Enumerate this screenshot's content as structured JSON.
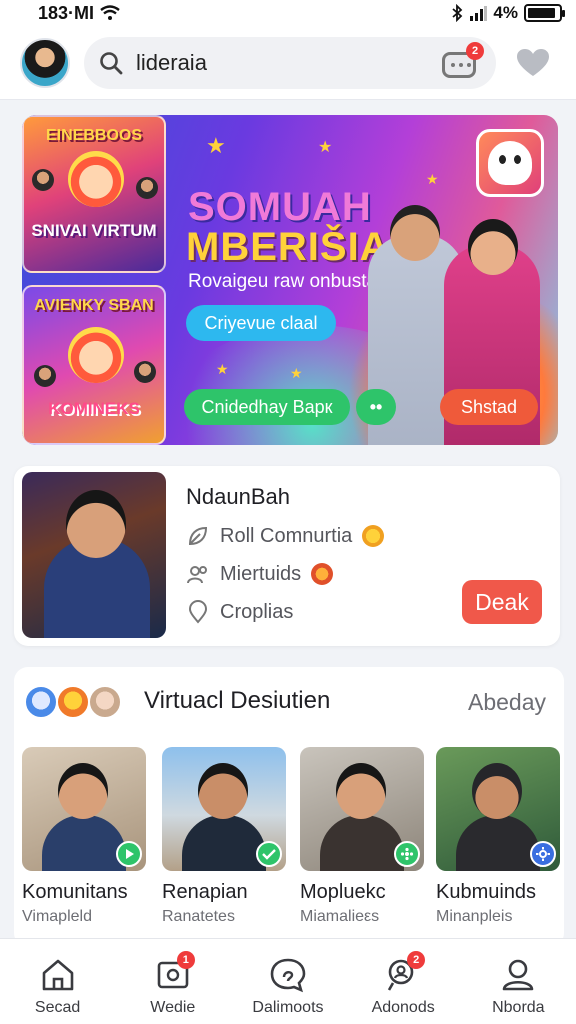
{
  "status": {
    "time": "183·MI",
    "battery": "4%",
    "battery_level": 0.9
  },
  "header": {
    "search_text": "lideraia",
    "chat_badge": "2"
  },
  "promo": {
    "thumb_top_title": "EINEBBOOS",
    "thumb_top_sub": "SNIVAI VIRTUM",
    "thumb_bottom_title": "AVIENKY SBAN",
    "thumb_bottom_sub": "KOMINEKS",
    "headline_1": "SOMUAH",
    "headline_2": "MBERIŠIA",
    "caption": "Rovaigeu raw onbustah",
    "button_primary": "Criyevue claal",
    "button_secondary": "Cnidedhay Bapк",
    "button_dots": "••",
    "button_orange": "Shstad"
  },
  "featured": {
    "name": "NdaunBah",
    "rows": [
      {
        "label": "Roll Comnurtia",
        "icon": "leaf-icon"
      },
      {
        "label": "Miertuids",
        "icon": "users-icon"
      },
      {
        "label": "Croplias",
        "icon": "pin-icon"
      }
    ],
    "button": "Deak"
  },
  "section": {
    "title": "Virtuacl Desiutien",
    "link": "Abeday",
    "cards": [
      {
        "title": "Komunitans",
        "sub": "Vimapleld",
        "badge_color": "#2ec46a"
      },
      {
        "title": "Renapian",
        "sub": "Ranatetes",
        "badge_color": "#2ec46a"
      },
      {
        "title": "Mopluekc",
        "sub": "Miamalieεs",
        "badge_color": "#2ec46a"
      },
      {
        "title": "Kubmuinds",
        "sub": "Minanpleis",
        "badge_color": "#3a6ee0"
      }
    ]
  },
  "nav": {
    "items": [
      {
        "label": "Secad",
        "icon": "home-icon"
      },
      {
        "label": "Wedie",
        "icon": "media-icon",
        "badge": "1"
      },
      {
        "label": "Dalimoots",
        "icon": "chat-bubble-icon"
      },
      {
        "label": "Adonods",
        "icon": "search-people-icon",
        "badge": "2"
      },
      {
        "label": "Nborda",
        "icon": "profile-icon"
      }
    ]
  },
  "colors": {
    "accent_orange": "#f0584a",
    "accent_green": "#2ec46a",
    "accent_blue": "#2db8ef"
  }
}
